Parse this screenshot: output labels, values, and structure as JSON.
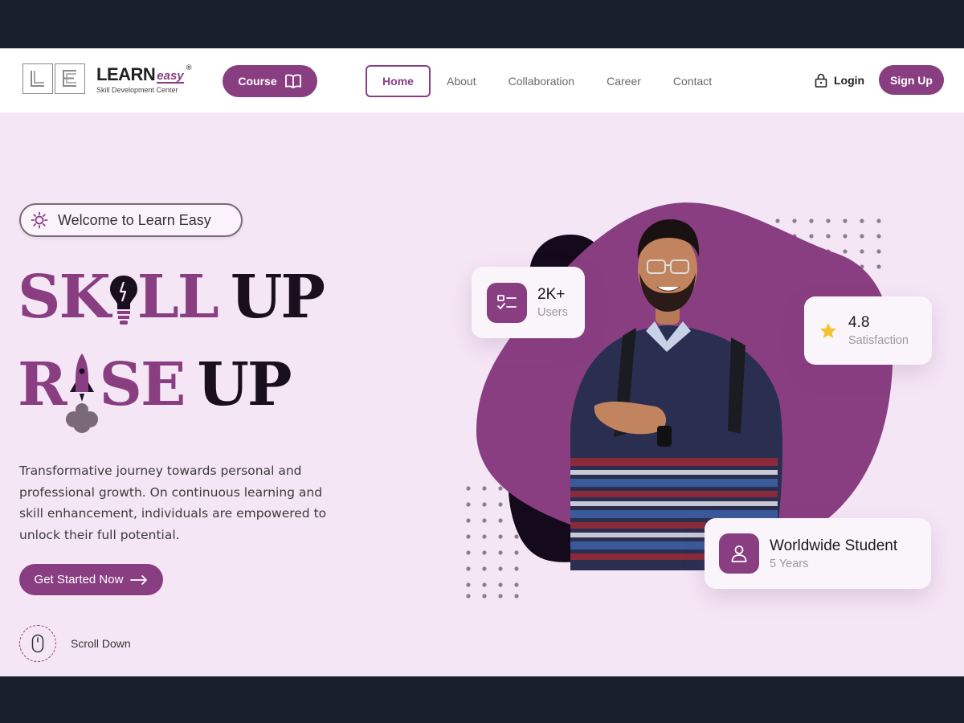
{
  "brand": {
    "name_bold": "LEARN",
    "name_accent": "easy",
    "registered": "®",
    "tagline": "Skill Development Center",
    "accent_color": "#8a3e82"
  },
  "header": {
    "course_button": "Course",
    "nav": [
      "Home",
      "About",
      "Collaboration",
      "Career",
      "Contact"
    ],
    "active_nav": "Home",
    "login": "Login",
    "signup": "Sign Up"
  },
  "hero": {
    "badge": "Welcome to Learn Easy",
    "headline_line1": {
      "part1": "SK",
      "part2": "LL",
      "part3": "UP"
    },
    "headline_line2": {
      "part1": "R",
      "part2": "SE",
      "part3": "UP"
    },
    "description": "Transformative journey towards personal and professional growth. On continuous learning and skill enhancement, individuals are empowered to unlock their full potential.",
    "cta": "Get Started Now",
    "scroll": "Scroll Down"
  },
  "stats": {
    "users": {
      "value": "2K+",
      "label": "Users",
      "icon": "checklist-icon"
    },
    "satisfaction": {
      "value": "4.8",
      "label": "Satisfaction",
      "icon": "star-icon"
    },
    "worldwide": {
      "value": "Worldwide Student",
      "label": "5 Years",
      "icon": "user-icon"
    }
  }
}
